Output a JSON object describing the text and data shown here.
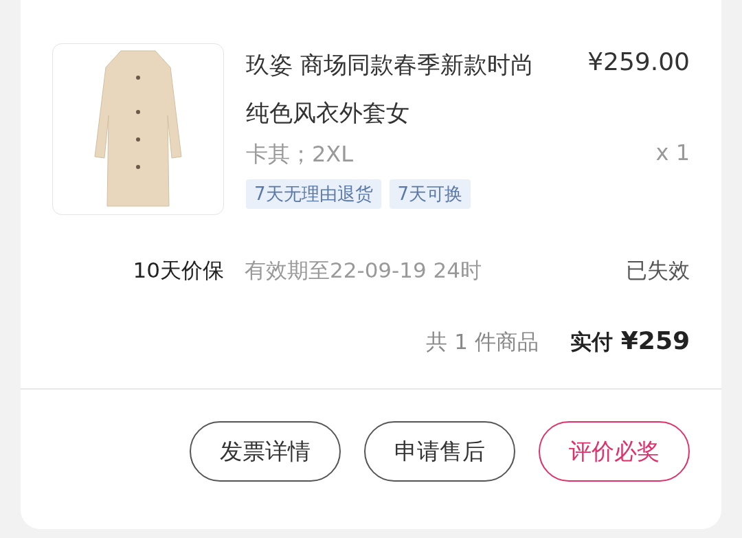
{
  "product": {
    "title": "玖姿 商场同款春季新款时尚纯色风衣外套女",
    "price": "¥259.00",
    "spec": "卡其；2XL",
    "quantity": "x 1",
    "tags": [
      "7天无理由退货",
      "7天可换"
    ]
  },
  "price_protection": {
    "label": "10天价保",
    "validity": "有效期至22-09-19 24时",
    "status": "已失效",
    "expired": true
  },
  "summary": {
    "count": "共 1 件商品",
    "paid_label": "实付",
    "paid_amount": "¥259"
  },
  "buttons": [
    {
      "label": "发票详情",
      "kind": "plain"
    },
    {
      "label": "申请售后",
      "kind": "plain"
    },
    {
      "label": "评价必奖",
      "kind": "primary"
    }
  ]
}
